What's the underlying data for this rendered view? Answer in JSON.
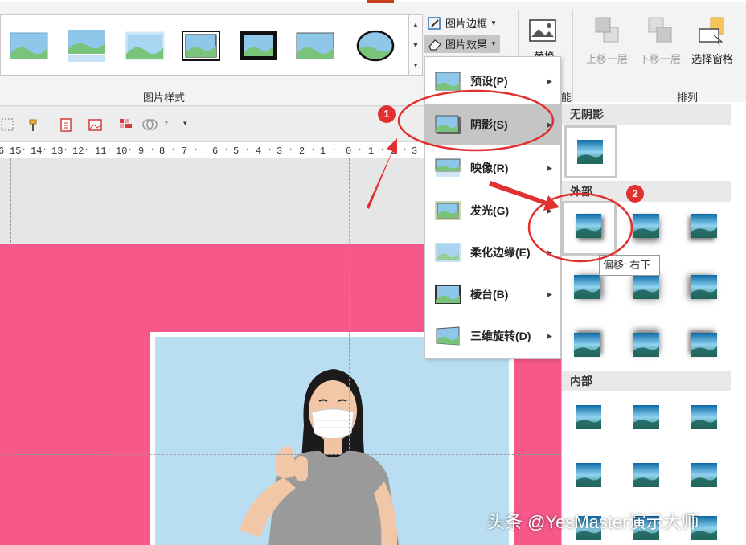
{
  "ribbon": {
    "picture_styles_label": "图片样式",
    "arrange_label": "排列",
    "partial_label": "能",
    "picture_border_label": "图片边框",
    "picture_effects_label": "图片效果",
    "replace_label": "替换",
    "bring_forward_label": "上移一层",
    "send_backward_label": "下移一层",
    "selection_pane_label": "选择窗格"
  },
  "ruler": {
    "labels": [
      "6",
      "15",
      "14",
      "13",
      "12",
      "11",
      "10",
      "9",
      "8",
      "7",
      "6",
      "5",
      "4",
      "3",
      "2",
      "1",
      "0",
      "1",
      "2",
      "3"
    ]
  },
  "effects_menu": {
    "items": [
      {
        "label": "预设(P)",
        "icon": "picture-icon"
      },
      {
        "label": "阴影(S)",
        "icon": "picture-icon"
      },
      {
        "label": "映像(R)",
        "icon": "picture-icon"
      },
      {
        "label": "发光(G)",
        "icon": "picture-icon"
      },
      {
        "label": "柔化边缘(E)",
        "icon": "picture-icon"
      },
      {
        "label": "棱台(B)",
        "icon": "picture-icon"
      },
      {
        "label": "三维旋转(D)",
        "icon": "picture-icon"
      }
    ],
    "active_index": 1
  },
  "shadow_submenu": {
    "no_shadow_label": "无阴影",
    "outer_label": "外部",
    "inner_label": "内部",
    "tooltip": "偏移: 右下"
  },
  "annotations": {
    "badge_1": "1",
    "badge_2": "2",
    "accent_color": "#e23030"
  },
  "watermark": "头条 @YesMaster演示大师",
  "colors": {
    "slide_bg": "#f6588a",
    "photo_bg": "#b9def2",
    "active_menu": "#c5c5c5"
  }
}
